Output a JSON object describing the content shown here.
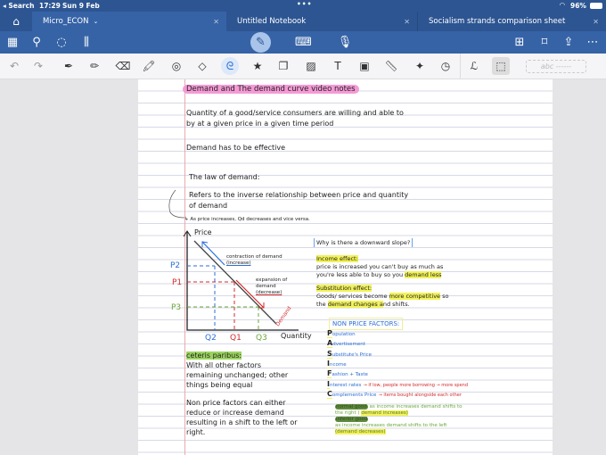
{
  "status": {
    "back": "◂ Search",
    "time": "17:29",
    "date": "Sun 9 Feb",
    "battery": "96%"
  },
  "tabs": [
    {
      "label": "Micro_ECON",
      "active": true
    },
    {
      "label": "Untitled Notebook"
    },
    {
      "label": "Socialism strands comparison sheet"
    }
  ],
  "toolbar": {
    "pen_mode_active": true
  },
  "tools": {
    "handwriting_placeholder": "abc ------"
  },
  "colors": {
    "brand": "#2d5592",
    "highlight_pink": "#f59ad6",
    "highlight_yellow": "#f2f25a"
  },
  "notes": {
    "title": "Demand and The demand curve video notes",
    "def1": "Quantity of a good/service consumers are willing and able to",
    "def2": "by at a given price in a given time period",
    "effective": "Demand has to be effective",
    "law": "The law of demand:",
    "refers1": "Refers to the inverse relationship between price and quantity",
    "refers2": "of demand",
    "arrow_note": "↳ As price increases, Qd decreases and vice versa.",
    "graph": {
      "y_label": "Price",
      "x_label": "Quantity",
      "p2": "P2",
      "p1": "P1",
      "p3": "P3",
      "q2": "Q2",
      "q1": "Q1",
      "q3": "Q3",
      "contraction": "contraction of demand",
      "contraction2": "(increase)",
      "expansion": "expansion of",
      "expansion2": "demand",
      "expansion3": "(decrease)",
      "demand": "Demand"
    },
    "why": "Why is there a downward slope?",
    "income_h": "Income effect:",
    "income1": "price is increased you can't buy as much as",
    "income2a": "you're less able to buy so you ",
    "income2b": "demand less",
    "subs_h": "Substitution effect:",
    "subs1a": "Goods/ services become ",
    "subs1b": "more competitive",
    " subs1c": " so",
    "subs1c": " so",
    "subs2a": "the ",
    "subs2b": "demand changes a",
    "subs2c": "nd shifts.",
    "ceteris_h": "ceteris paribus:",
    "ceteris1": "With all other factors",
    "ceteris2": "remaining unchanged; other",
    "ceteris3": "things being equal",
    "npf1": "Non price factors can either",
    "npf2": "reduce or increase demand",
    "npf3": "resulting in a shift to the left or",
    "npf4": "right.",
    "non_price_title": "NON PRICE FACTORS:",
    "pasific": [
      {
        "letter": "P",
        "rest": "opulation"
      },
      {
        "letter": "A",
        "rest": "dvertisement"
      },
      {
        "letter": "S",
        "rest": "ubstitute's Price"
      },
      {
        "letter": "I",
        "rest": "ncome"
      },
      {
        "letter": "F",
        "rest": "ashion + Taste"
      },
      {
        "letter": "I",
        "rest": "nterest rates",
        "note": "→ if low, people more borrowing → more spend"
      },
      {
        "letter": "C",
        "rest": "omplements Price",
        "note": "→ items bought alongside each other"
      }
    ],
    "normal_good": "normal good",
    "normal_text": " as income increases demand shifts to",
    "normal_text2": "the right ( ",
    "normal_hl": "demand increases)",
    "inferior_good": "inferior good",
    "inferior_text": "as income increases demand shifts to the left",
    "inferior_hl": "(demand decreases)"
  }
}
